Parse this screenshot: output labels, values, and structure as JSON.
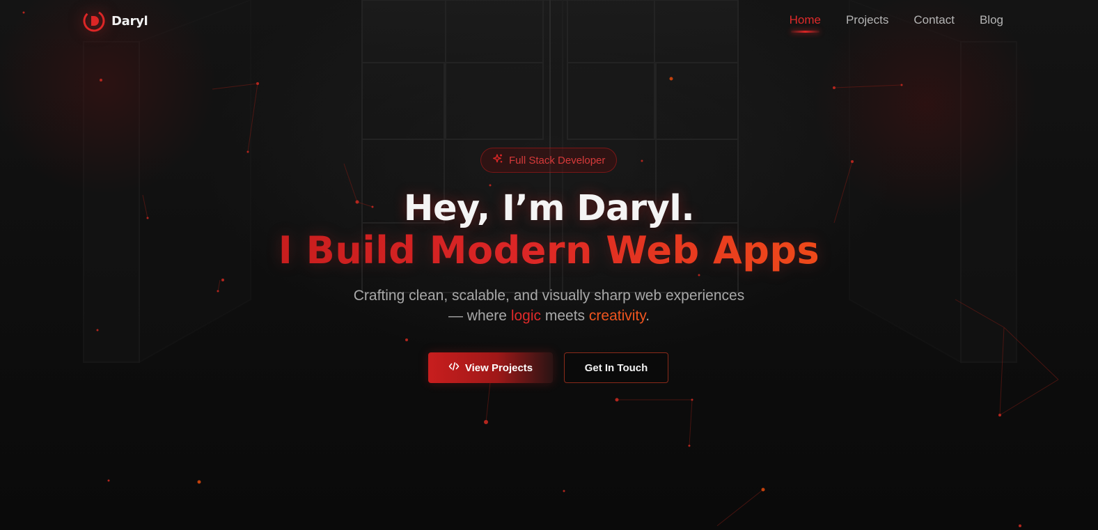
{
  "brand": {
    "name": "Daryl",
    "logo_icon": "d-logo-icon",
    "accent": "#dc2626",
    "accent_secondary": "#f0551f"
  },
  "nav": {
    "items": [
      {
        "label": "Home",
        "active": true
      },
      {
        "label": "Projects",
        "active": false
      },
      {
        "label": "Contact",
        "active": false
      },
      {
        "label": "Blog",
        "active": false
      }
    ]
  },
  "hero": {
    "badge": {
      "icon": "sparkle-icon",
      "label": "Full Stack Developer"
    },
    "title_line1": "Hey, I’m Daryl.",
    "title_line2": "I Build Modern Web Apps",
    "subtitle": {
      "line1": "Crafting clean, scalable, and visually sharp web experiences",
      "line2_prefix": "— where ",
      "highlight1": "logic",
      "line2_middle": " meets ",
      "highlight2": "creativity",
      "line2_suffix": "."
    },
    "buttons": {
      "primary": {
        "icon": "code-icon",
        "label": "View Projects"
      },
      "secondary": {
        "label": "Get In Touch"
      }
    }
  }
}
